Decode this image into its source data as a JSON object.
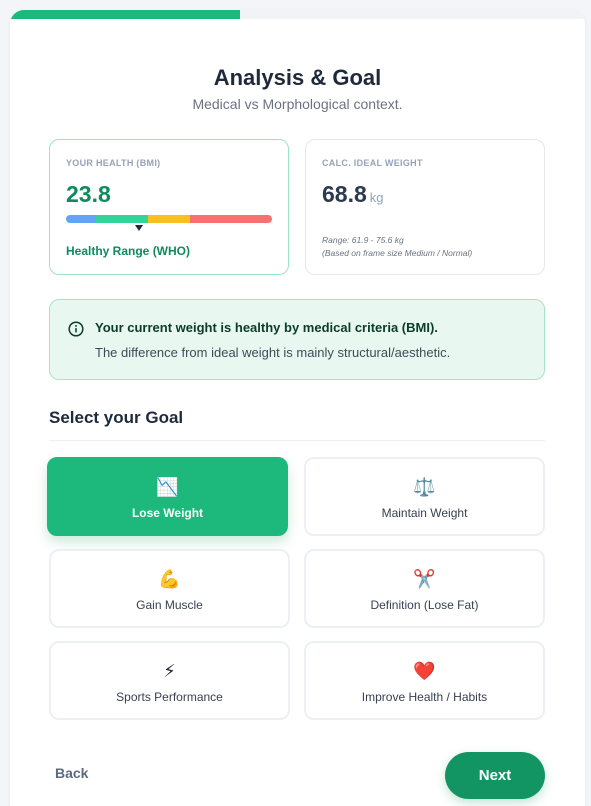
{
  "progress": {
    "fraction": 0.4,
    "color": "#1db97c"
  },
  "header": {
    "title": "Analysis & Goal",
    "subtitle": "Medical vs Morphological context."
  },
  "bmi_card": {
    "label": "YOUR HEALTH (BMI)",
    "value": "23.8",
    "range_label": "Healthy Range (WHO)",
    "scale_colors": [
      "#60a5fa",
      "#34d399",
      "#fbbf24",
      "#f87171"
    ]
  },
  "ideal_card": {
    "label": "CALC. IDEAL WEIGHT",
    "value": "68.8",
    "unit": "kg",
    "range_note": "Range: 61.9 - 75.6 kg",
    "frame_note": "(Based on frame size Medium / Normal)"
  },
  "alert": {
    "icon": "info-circle-icon",
    "title": "Your current weight is healthy by medical criteria (BMI).",
    "body": "The difference from ideal weight is mainly structural/aesthetic."
  },
  "goals": {
    "heading": "Select your Goal",
    "items": [
      {
        "label": "Lose Weight",
        "icon": "📉",
        "icon_name": "chart-decreasing-icon",
        "selected": true
      },
      {
        "label": "Maintain Weight",
        "icon": "⚖️",
        "icon_name": "balance-scale-icon",
        "selected": false
      },
      {
        "label": "Gain Muscle",
        "icon": "💪",
        "icon_name": "flexed-biceps-icon",
        "selected": false
      },
      {
        "label": "Definition (Lose Fat)",
        "icon": "✂️",
        "icon_name": "scissors-icon",
        "selected": false
      },
      {
        "label": "Sports Performance",
        "icon": "⚡",
        "icon_name": "lightning-icon",
        "selected": false
      },
      {
        "label": "Improve Health / Habits",
        "icon": "❤️",
        "icon_name": "heart-icon",
        "selected": false
      }
    ]
  },
  "nav": {
    "back_label": "Back",
    "next_label": "Next"
  }
}
